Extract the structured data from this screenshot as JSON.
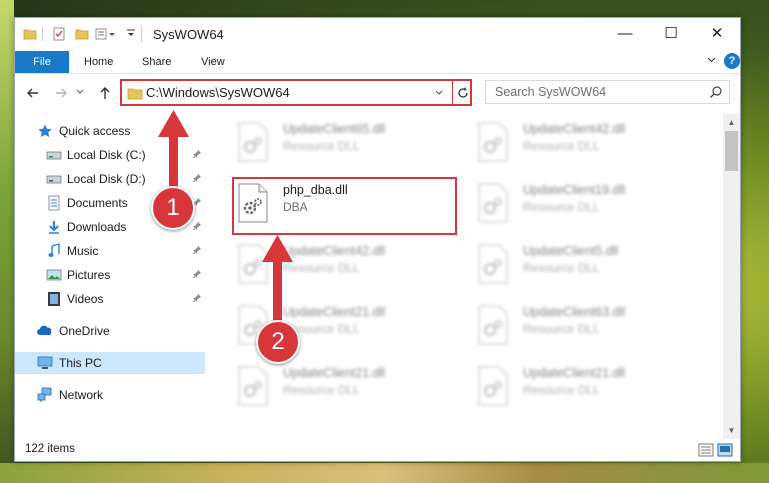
{
  "window": {
    "title": "SysWOW64",
    "controls": {
      "minimize": "—",
      "maximize": "☐",
      "close": "✕"
    }
  },
  "ribbon": {
    "tabs": [
      {
        "label": "File"
      },
      {
        "label": "Home"
      },
      {
        "label": "Share"
      },
      {
        "label": "View"
      }
    ],
    "help": "?"
  },
  "navbar": {
    "address": "C:\\Windows\\SysWOW64",
    "search_placeholder": "Search SysWOW64"
  },
  "sidebar": {
    "items": [
      {
        "label": "Quick access",
        "icon": "star-icon"
      },
      {
        "label": "Local Disk (C:)",
        "icon": "drive-icon",
        "pinned": true
      },
      {
        "label": "Local Disk (D:)",
        "icon": "drive-icon",
        "pinned": true
      },
      {
        "label": "Documents",
        "icon": "documents-icon",
        "pinned": true
      },
      {
        "label": "Downloads",
        "icon": "downloads-icon",
        "pinned": true
      },
      {
        "label": "Music",
        "icon": "music-icon",
        "pinned": true
      },
      {
        "label": "Pictures",
        "icon": "pictures-icon",
        "pinned": true
      },
      {
        "label": "Videos",
        "icon": "videos-icon",
        "pinned": true
      },
      {
        "label": "OneDrive",
        "icon": "onedrive-icon"
      },
      {
        "label": "This PC",
        "icon": "pc-icon",
        "selected": true
      },
      {
        "label": "Network",
        "icon": "network-icon"
      }
    ]
  },
  "files": [
    {
      "name": "UpdateClient65.dll",
      "desc": "Resource DLL"
    },
    {
      "name": "UpdateClient42.dll",
      "desc": "Resource DLL"
    },
    {
      "name": "php_dba.dll",
      "desc": "DBA",
      "highlighted": true
    },
    {
      "name": "UpdateClient19.dll",
      "desc": "Resource DLL"
    },
    {
      "name": "UpdateClient42.dll",
      "desc": "Resource DLL"
    },
    {
      "name": "UpdateClient5.dll",
      "desc": "Resource DLL"
    },
    {
      "name": "UpdateClient21.dll",
      "desc": "Resource DLL"
    },
    {
      "name": "UpdateClient63.dll",
      "desc": "Resource DLL"
    },
    {
      "name": "UpdateClient21.dll",
      "desc": "Resource DLL"
    },
    {
      "name": "UpdateClient21.dll",
      "desc": "Resource DLL"
    }
  ],
  "status": {
    "item_count": "122 items"
  },
  "callouts": [
    {
      "number": "1"
    },
    {
      "number": "2"
    }
  ],
  "colors": {
    "accent": "#1979ca",
    "highlight_red": "#d7363a",
    "selection": "#cce8ff"
  }
}
